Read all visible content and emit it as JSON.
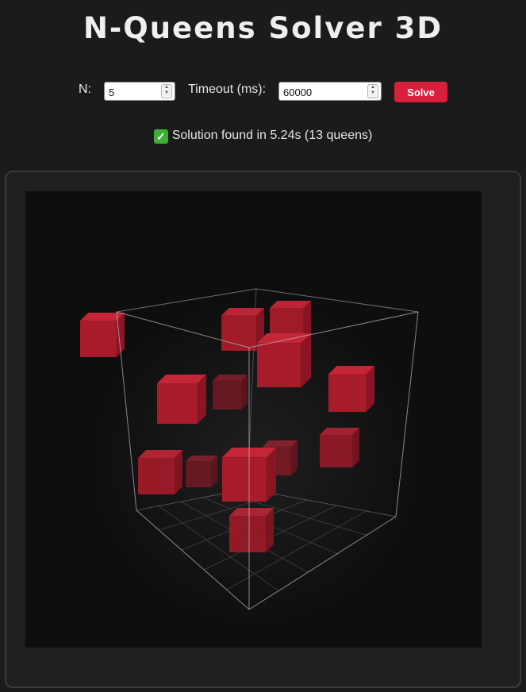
{
  "app": {
    "title": "N-Queens Solver 3D"
  },
  "controls": {
    "n_label": "N:",
    "n_value": "5",
    "timeout_label": "Timeout (ms):",
    "timeout_value": "60000",
    "solve_label": "Solve"
  },
  "status": {
    "text": "Solution found in 5.24s (13 queens)",
    "icon": "check-mark-icon",
    "icon_color": "#3cb034"
  },
  "scene": {
    "board_size": 5,
    "queen_count": 13,
    "queen_color": "#b31b29"
  },
  "colors": {
    "background": "#1b1b1b",
    "viewport": "#0e0e0e",
    "accent": "#d91f3a"
  }
}
